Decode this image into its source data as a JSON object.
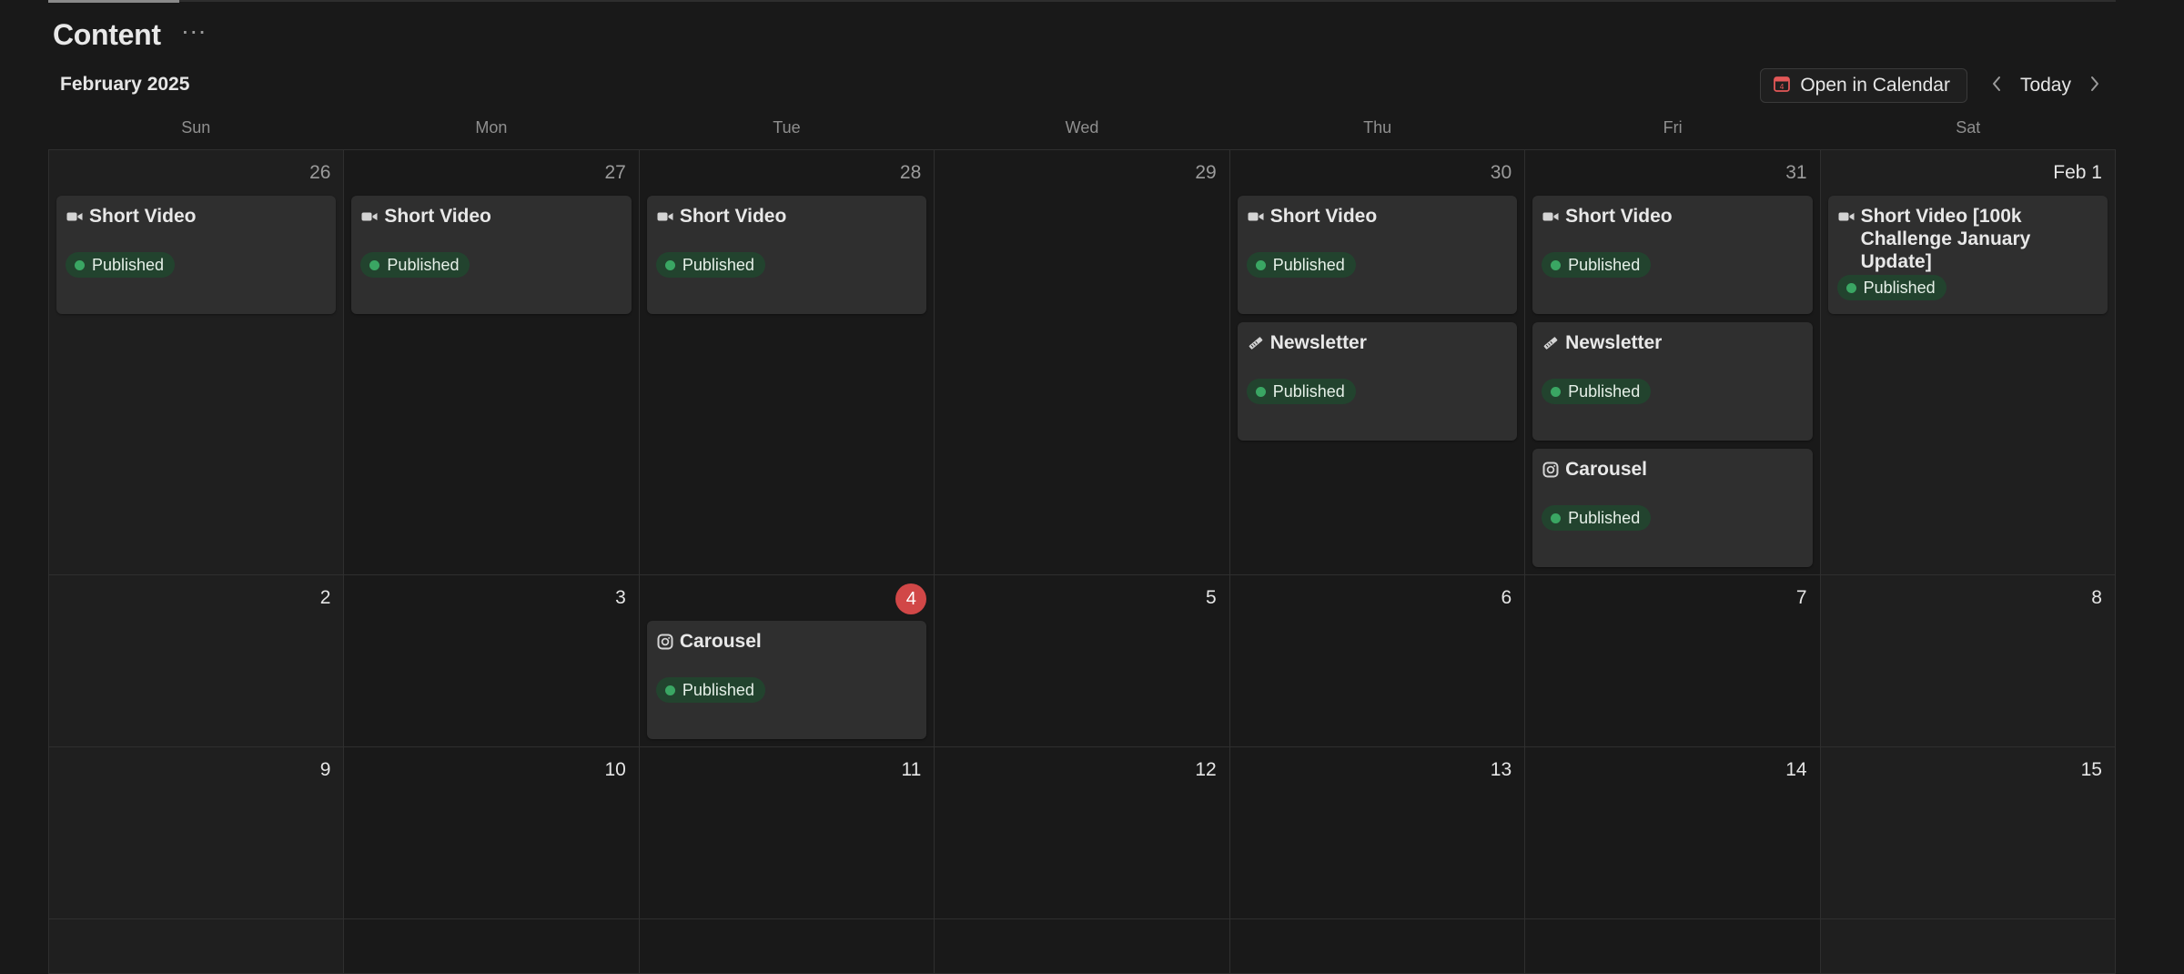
{
  "page": {
    "title": "Content"
  },
  "calendar": {
    "month_label": "February 2025",
    "open_in_calendar": "Open in Calendar",
    "today_label": "Today",
    "weekdays": [
      "Sun",
      "Mon",
      "Tue",
      "Wed",
      "Thu",
      "Fri",
      "Sat"
    ],
    "accent_today": "#d14747",
    "status_color": "#3aa663",
    "weeks": [
      {
        "days": [
          {
            "day": "26",
            "events": [
              {
                "icon": "video-camera-icon",
                "title": "Short Video",
                "status": "Published"
              }
            ]
          },
          {
            "day": "27",
            "events": [
              {
                "icon": "video-camera-icon",
                "title": "Short Video",
                "status": "Published"
              }
            ]
          },
          {
            "day": "28",
            "events": [
              {
                "icon": "video-camera-icon",
                "title": "Short Video",
                "status": "Published"
              }
            ]
          },
          {
            "day": "29",
            "events": []
          },
          {
            "day": "30",
            "events": [
              {
                "icon": "video-camera-icon",
                "title": "Short Video",
                "status": "Published"
              },
              {
                "icon": "newspaper-icon",
                "title": "Newsletter",
                "status": "Published"
              }
            ]
          },
          {
            "day": "31",
            "events": [
              {
                "icon": "video-camera-icon",
                "title": "Short Video",
                "status": "Published"
              },
              {
                "icon": "newspaper-icon",
                "title": "Newsletter",
                "status": "Published"
              },
              {
                "icon": "instagram-icon",
                "title": "Carousel",
                "status": "Published"
              }
            ]
          },
          {
            "day": "Feb 1",
            "events": [
              {
                "icon": "video-camera-icon",
                "title": "Short Video [100k Challenge January Update]",
                "status": "Published"
              }
            ]
          }
        ]
      },
      {
        "days": [
          {
            "day": "2",
            "events": []
          },
          {
            "day": "3",
            "events": []
          },
          {
            "day": "4",
            "events": [
              {
                "icon": "instagram-icon",
                "title": "Carousel",
                "status": "Published"
              }
            ]
          },
          {
            "day": "5",
            "events": []
          },
          {
            "day": "6",
            "events": []
          },
          {
            "day": "7",
            "events": []
          },
          {
            "day": "8",
            "events": []
          }
        ]
      },
      {
        "days": [
          {
            "day": "9",
            "events": []
          },
          {
            "day": "10",
            "events": []
          },
          {
            "day": "11",
            "events": []
          },
          {
            "day": "12",
            "events": []
          },
          {
            "day": "13",
            "events": []
          },
          {
            "day": "14",
            "events": []
          },
          {
            "day": "15",
            "events": []
          }
        ]
      },
      {
        "days": [
          {
            "day": "",
            "events": []
          },
          {
            "day": "",
            "events": []
          },
          {
            "day": "",
            "events": []
          },
          {
            "day": "",
            "events": []
          },
          {
            "day": "",
            "events": []
          },
          {
            "day": "",
            "events": []
          },
          {
            "day": "",
            "events": []
          }
        ]
      }
    ]
  }
}
